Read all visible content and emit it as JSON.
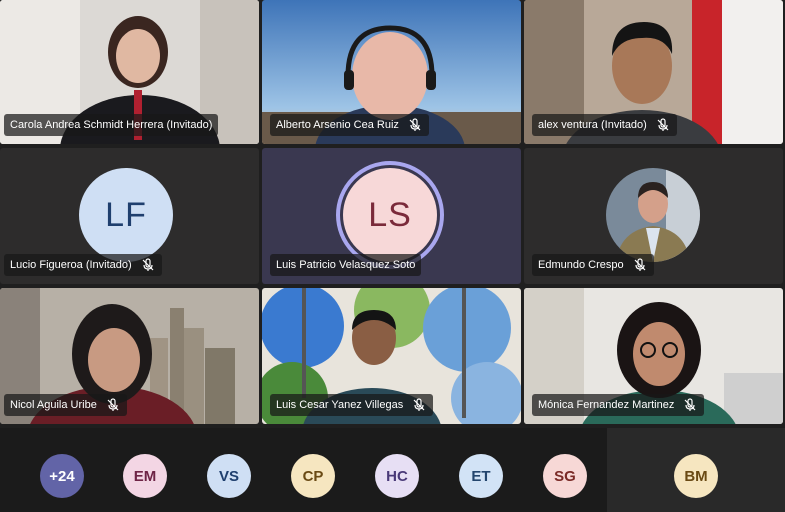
{
  "participants": [
    {
      "name": "Carola Andrea Schmidt Herrera (Invitado)",
      "muted": false
    },
    {
      "name": "Alberto Arsenio Cea Ruiz",
      "muted": true
    },
    {
      "name": "alex ventura (Invitado)",
      "muted": true
    },
    {
      "name": "Lucio Figueroa (Invitado)",
      "muted": true,
      "initials": "LF"
    },
    {
      "name": "Luis Patricio Velasquez Soto",
      "muted": false,
      "initials": "LS"
    },
    {
      "name": "Edmundo Crespo",
      "muted": true
    },
    {
      "name": "Nicol Aguila Uribe",
      "muted": true
    },
    {
      "name": "Luis Cesar Yanez Villegas",
      "muted": true
    },
    {
      "name": "Mónica Fernandez Martinez",
      "muted": true
    }
  ],
  "overflow_strip": [
    {
      "label": "+24",
      "bg": "#6264a7",
      "fg": "#ffffff"
    },
    {
      "label": "EM",
      "bg": "#f3d6e4",
      "fg": "#6e2446"
    },
    {
      "label": "VS",
      "bg": "#cfdff4",
      "fg": "#1f3f6e"
    },
    {
      "label": "CP",
      "bg": "#f6e6c0",
      "fg": "#6a4a14"
    },
    {
      "label": "HC",
      "bg": "#e7dff4",
      "fg": "#4a3a78"
    },
    {
      "label": "ET",
      "bg": "#d2e3f6",
      "fg": "#24466e"
    },
    {
      "label": "SG",
      "bg": "#f7d8d6",
      "fg": "#7a2a26"
    }
  ],
  "self_preview": {
    "initials": "BM",
    "bg": "#f6e6c0",
    "fg": "#6a4a14"
  },
  "colors": {
    "lf_avatar_bg": "#cfdff4",
    "lf_avatar_fg": "#1f3f6e",
    "ls_avatar_bg": "#f7d8d8",
    "ls_avatar_fg": "#7a2a3a",
    "speaking_ring": "#a9a7ef"
  }
}
